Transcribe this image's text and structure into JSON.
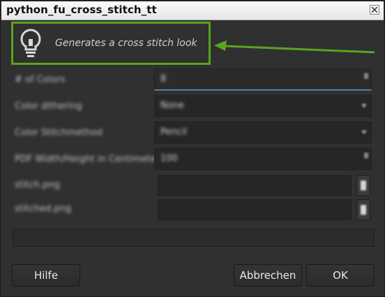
{
  "window": {
    "title": "python_fu_cross_stitch_tt"
  },
  "description": {
    "icon": "lightbulb-icon",
    "text": "Generates a cross stitch look"
  },
  "annotation": {
    "box_color": "#59a51d",
    "arrow_color": "#59a51d"
  },
  "params": {
    "row1": {
      "label": "# of Colors",
      "value": "8"
    },
    "row2": {
      "label": "Color dithering",
      "value": "None"
    },
    "row3": {
      "label": "Color Stitchmethod",
      "value": "Pencil"
    },
    "row4": {
      "label": "PDF Width/Height in Centimeter",
      "value": "100"
    },
    "row5": {
      "label": "stitch.png",
      "value": ""
    },
    "row6": {
      "label": "stitched.png",
      "value": ""
    }
  },
  "buttons": {
    "help": "Hilfe",
    "cancel": "Abbrechen",
    "ok": "OK"
  }
}
